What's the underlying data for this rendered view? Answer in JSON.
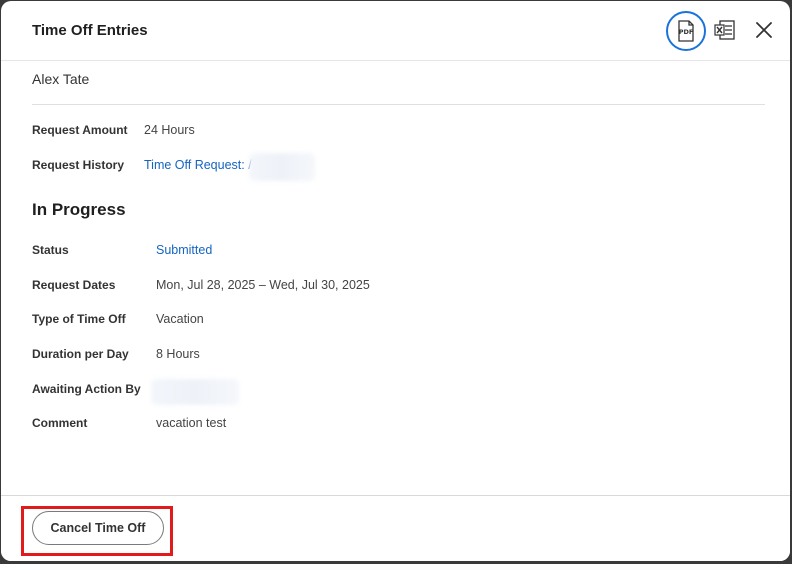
{
  "dialog": {
    "title": "Time Off Entries",
    "worker_name": "Alex Tate",
    "icons": {
      "pdf": "pdf-icon",
      "excel": "excel-export-icon",
      "close": "close-icon"
    }
  },
  "summary": {
    "request_amount_label": "Request Amount",
    "request_amount_value": "24 Hours",
    "request_history_label": "Request History",
    "request_history_value": "Time Off Request: /"
  },
  "entry": {
    "section_title": "In Progress",
    "status_label": "Status",
    "status_value": "Submitted",
    "request_dates_label": "Request Dates",
    "request_dates_value": "Mon, Jul 28, 2025 – Wed, Jul 30, 2025",
    "type_label": "Type of Time Off",
    "type_value": "Vacation",
    "duration_label": "Duration per Day",
    "duration_value": "8 Hours",
    "awaiting_label": "Awaiting Action By",
    "comment_label": "Comment",
    "comment_value": "vacation test"
  },
  "footer": {
    "cancel_label": "Cancel Time Off"
  },
  "colors": {
    "accent": "#1a73d9",
    "link": "#1565c0",
    "highlight": "#e11b1b"
  }
}
